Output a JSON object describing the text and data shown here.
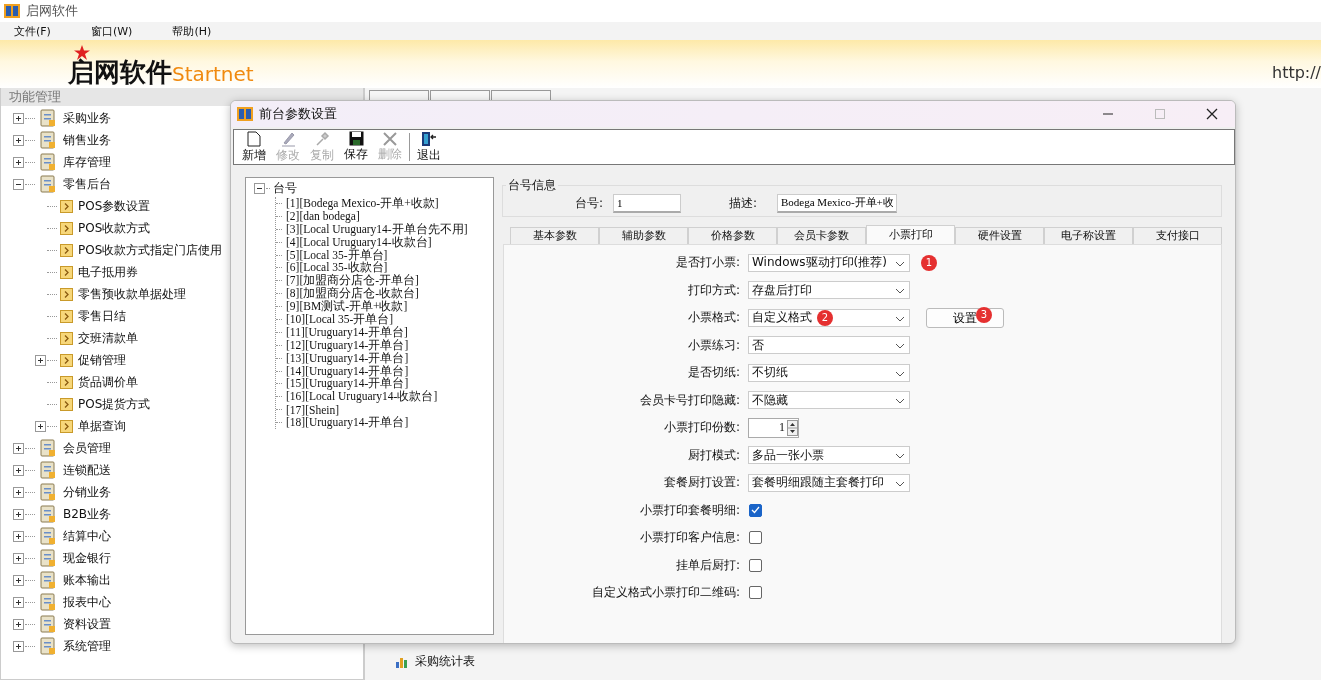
{
  "app": {
    "title": "启网软件"
  },
  "menu": [
    "文件(F)",
    "窗口(W)",
    "帮助(H)"
  ],
  "banner": {
    "logo_cn": "启网软件",
    "logo_en": "Startnet",
    "url": "http://"
  },
  "sidebar": {
    "title": "功能管理",
    "items": [
      {
        "label": "采购业务",
        "kind": "branch",
        "expanded": false
      },
      {
        "label": "销售业务",
        "kind": "branch",
        "expanded": false
      },
      {
        "label": "库存管理",
        "kind": "branch",
        "expanded": false
      },
      {
        "label": "零售后台",
        "kind": "branch",
        "expanded": true,
        "children": [
          {
            "label": "POS参数设置",
            "kind": "leaf"
          },
          {
            "label": "POS收款方式",
            "kind": "leaf"
          },
          {
            "label": "POS收款方式指定门店使用",
            "kind": "leaf"
          },
          {
            "label": "电子抵用券",
            "kind": "leaf"
          },
          {
            "label": "零售预收款单据处理",
            "kind": "leaf"
          },
          {
            "label": "零售日结",
            "kind": "leaf"
          },
          {
            "label": "交班清款单",
            "kind": "leaf"
          },
          {
            "label": "促销管理",
            "kind": "branch",
            "expanded": false
          },
          {
            "label": "货品调价单",
            "kind": "leaf"
          },
          {
            "label": "POS提货方式",
            "kind": "leaf"
          },
          {
            "label": "单据查询",
            "kind": "branch",
            "expanded": false
          }
        ]
      },
      {
        "label": "会员管理",
        "kind": "branch",
        "expanded": false
      },
      {
        "label": "连锁配送",
        "kind": "branch",
        "expanded": false
      },
      {
        "label": "分销业务",
        "kind": "branch",
        "expanded": false
      },
      {
        "label": "B2B业务",
        "kind": "branch",
        "expanded": false
      },
      {
        "label": "结算中心",
        "kind": "branch",
        "expanded": false
      },
      {
        "label": "现金银行",
        "kind": "branch",
        "expanded": false
      },
      {
        "label": "账本输出",
        "kind": "branch",
        "expanded": false
      },
      {
        "label": "报表中心",
        "kind": "branch",
        "expanded": false
      },
      {
        "label": "资料设置",
        "kind": "branch",
        "expanded": false
      },
      {
        "label": "系统管理",
        "kind": "branch",
        "expanded": false
      }
    ]
  },
  "workspace": {
    "report_link": "采购统计表"
  },
  "dialog": {
    "title": "前台参数设置",
    "toolbar": [
      {
        "label": "新增",
        "kind": "new",
        "disabled": false
      },
      {
        "label": "修改",
        "kind": "edit",
        "disabled": true
      },
      {
        "label": "复制",
        "kind": "copy",
        "disabled": true
      },
      {
        "label": "保存",
        "kind": "save",
        "disabled": false
      },
      {
        "label": "删除",
        "kind": "delete",
        "disabled": true
      },
      {
        "label": "退出",
        "kind": "exit",
        "disabled": false
      }
    ],
    "tree": {
      "label": "台号",
      "expanded": true,
      "children": [
        "[1][Bodega Mexico-开单+收款]",
        "[2][dan bodega]",
        "[3][Local Uruguary14-开单台先不用]",
        "[4][Local Uruguary14-收款台]",
        "[5][Local 35-开单台]",
        "[6][Local 35-收款台]",
        "[7][加盟商分店仓-开单台]",
        "[8][加盟商分店仓-收款台]",
        "[9][BM测试-开单+收款]",
        "[10][Local 35-开单台]",
        "[11][Uruguary14-开单台]",
        "[12][Uruguary14-开单台]",
        "[13][Uruguary14-开单台]",
        "[14][Uruguary14-开单台]",
        "[15][Uruguary14-开单台]",
        "[16][Local Uruguary14-收款台]",
        "[17][Shein]",
        "[18][Uruguary14-开单台]"
      ]
    },
    "info": {
      "title": "台号信息",
      "fields": [
        {
          "label": "台号:",
          "value": "1"
        },
        {
          "label": "描述:",
          "value": "Bodega Mexico-开单+收"
        }
      ]
    },
    "tabs": [
      {
        "label": "基本参数",
        "selected": false
      },
      {
        "label": "辅助参数",
        "selected": false
      },
      {
        "label": "价格参数",
        "selected": false
      },
      {
        "label": "会员卡参数",
        "selected": false
      },
      {
        "label": "小票打印",
        "selected": true
      },
      {
        "label": "硬件设置",
        "selected": false
      },
      {
        "label": "电子称设置",
        "selected": false
      },
      {
        "label": "支付接口",
        "selected": false
      }
    ],
    "rows": [
      {
        "kind": "select",
        "label": "是否打小票:",
        "value": "Windows驱动打印(推荐)",
        "badge": "1"
      },
      {
        "kind": "select",
        "label": "打印方式:",
        "value": "存盘后打印"
      },
      {
        "kind": "select",
        "label": "小票格式:",
        "value": "自定义格式",
        "badge": "2",
        "button": {
          "label": "设置",
          "badge": "3"
        }
      },
      {
        "kind": "select",
        "label": "小票练习:",
        "value": "否"
      },
      {
        "kind": "select",
        "label": "是否切纸:",
        "value": "不切纸"
      },
      {
        "kind": "select",
        "label": "会员卡号打印隐藏:",
        "value": "不隐藏"
      },
      {
        "kind": "spin",
        "label": "小票打印份数:",
        "value": "1"
      },
      {
        "kind": "select",
        "label": "厨打模式:",
        "value": "多品一张小票"
      },
      {
        "kind": "select",
        "label": "套餐厨打设置:",
        "value": "套餐明细跟随主套餐打印"
      },
      {
        "kind": "checkbox",
        "label": "小票打印套餐明细:",
        "checked": true
      },
      {
        "kind": "checkbox",
        "label": "小票打印客户信息:",
        "checked": false
      },
      {
        "kind": "checkbox",
        "label": "挂单后厨打:",
        "checked": false
      },
      {
        "kind": "checkbox",
        "label": "自定义格式小票打印二维码:",
        "checked": false
      }
    ]
  }
}
